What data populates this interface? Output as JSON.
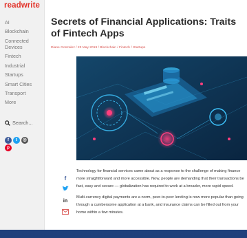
{
  "brand": {
    "logo_text": "readwrite",
    "logo_color": "#e2342b"
  },
  "sidebar": {
    "items": [
      {
        "label": "AI"
      },
      {
        "label": "Blockchain"
      },
      {
        "label": "Connected Devices"
      },
      {
        "label": "Fintech"
      },
      {
        "label": "Industrial"
      },
      {
        "label": "Startups"
      },
      {
        "label": "Smart Cities"
      },
      {
        "label": "Transport"
      },
      {
        "label": "More"
      }
    ],
    "search_label": "Search...",
    "social_icons": [
      "facebook-icon",
      "twitter-icon",
      "instagram-icon",
      "pinterest-icon"
    ]
  },
  "article": {
    "title": "Secrets of Financial Applications: Traits of Fintech Apps",
    "author": "Diane Gonzalez",
    "date": "23 May 2019",
    "categories": [
      "Blockchain",
      "Fintech",
      "Startups"
    ],
    "separator": " / ",
    "paragraphs": [
      "Technology for financial services came about as a response to the challenge of making finance more straightforward and more accessible. Now, people are demanding that their transactions be fast, easy and secure — globalization has required to work at a broader, more rapid speed.",
      "Multi-currency digital payments are a norm, peer-to-peer lending is now more popular than going through a cumbersome application at a bank, and insurance claims can be filled out from your home within a few minutes."
    ]
  },
  "share_icons": [
    "facebook-share-icon",
    "twitter-share-icon",
    "linkedin-share-icon",
    "email-share-icon"
  ],
  "colors": {
    "accent": "#d9534f",
    "hero_bg": "#0f2f4e",
    "hero_neon_blue": "#3fc6ff",
    "hero_neon_pink": "#ff3e7e",
    "frame_bg": "#2a5398"
  }
}
